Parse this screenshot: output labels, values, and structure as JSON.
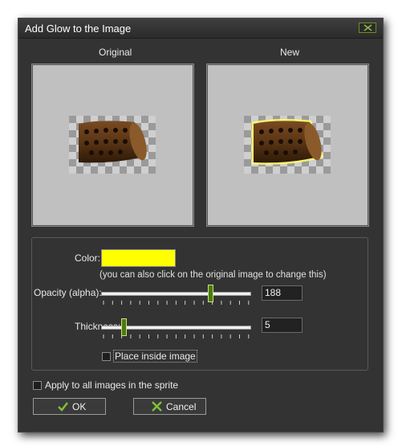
{
  "window": {
    "title": "Add Glow to the Image"
  },
  "preview": {
    "original_label": "Original",
    "new_label": "New"
  },
  "color": {
    "label": "Color:",
    "value": "#ffff00",
    "hint": "(you can also click on the original image to change this)"
  },
  "opacity": {
    "label": "Opacity (alpha):",
    "value": "188",
    "level": 0.737
  },
  "thickness": {
    "label": "Thickness:",
    "value": "5",
    "level": 0.15
  },
  "place_inside": {
    "label": "Place inside image",
    "checked": false
  },
  "apply_all": {
    "label": "Apply to all images in the sprite",
    "checked": false
  },
  "buttons": {
    "ok": "OK",
    "cancel": "Cancel"
  },
  "icons": {
    "close": "close-x-icon",
    "ok": "checkmark-icon",
    "cancel": "cross-icon"
  },
  "colors": {
    "accent": "#6b8e23",
    "glow": "#ffff00",
    "background": "#333333"
  }
}
